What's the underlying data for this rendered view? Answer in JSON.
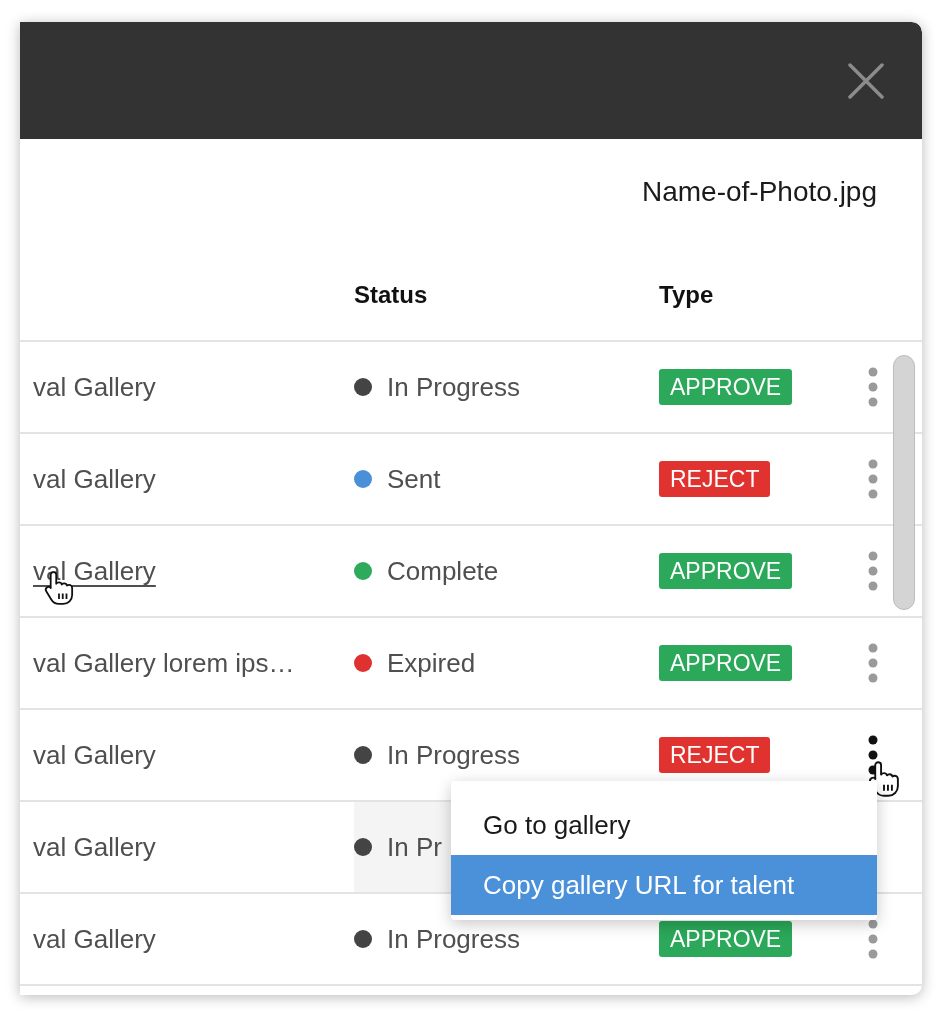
{
  "file_name": "Name-of-Photo.jpg",
  "table": {
    "columns": [
      "Status",
      "Type"
    ],
    "rows": [
      {
        "column_1": "val Gallery",
        "link_hovered": false,
        "highlighted": false,
        "status": {
          "label": "In Progress",
          "color": "#444444"
        },
        "type": {
          "label": "APPROVE",
          "kind": "approve"
        },
        "more_button": {
          "active": false
        }
      },
      {
        "column_1": "val Gallery",
        "link_hovered": false,
        "highlighted": false,
        "status": {
          "label": "Sent",
          "color": "#4a90d9"
        },
        "type": {
          "label": "REJECT",
          "kind": "reject"
        },
        "more_button": {
          "active": false
        }
      },
      {
        "column_1": "val Gallery",
        "link_hovered": true,
        "highlighted": false,
        "status": {
          "label": "Complete",
          "color": "#2eaa5c"
        },
        "type": {
          "label": "APPROVE",
          "kind": "approve"
        },
        "more_button": {
          "active": false
        }
      },
      {
        "column_1": "val Gallery lorem ips…",
        "link_hovered": false,
        "highlighted": false,
        "status": {
          "label": "Expired",
          "color": "#e03131"
        },
        "type": {
          "label": "APPROVE",
          "kind": "approve"
        },
        "more_button": {
          "active": false
        }
      },
      {
        "column_1": "val Gallery",
        "link_hovered": false,
        "highlighted": false,
        "status": {
          "label": "In Progress",
          "color": "#444444"
        },
        "type": {
          "label": "REJECT",
          "kind": "reject"
        },
        "more_button": {
          "active": true
        }
      },
      {
        "column_1": "val Gallery",
        "link_hovered": false,
        "highlighted": true,
        "status": {
          "label": "In Pr",
          "color": "#444444"
        }
      },
      {
        "column_1": "val Gallery",
        "link_hovered": false,
        "highlighted": false,
        "status": {
          "label": "In Progress",
          "color": "#444444"
        },
        "type": {
          "label": "APPROVE",
          "kind": "approve"
        },
        "more_button": {
          "active": false
        }
      }
    ]
  },
  "context_menu": {
    "items": [
      {
        "label": "Go to gallery",
        "selected": false
      },
      {
        "label": "Copy gallery URL for talent",
        "selected": true
      }
    ]
  }
}
